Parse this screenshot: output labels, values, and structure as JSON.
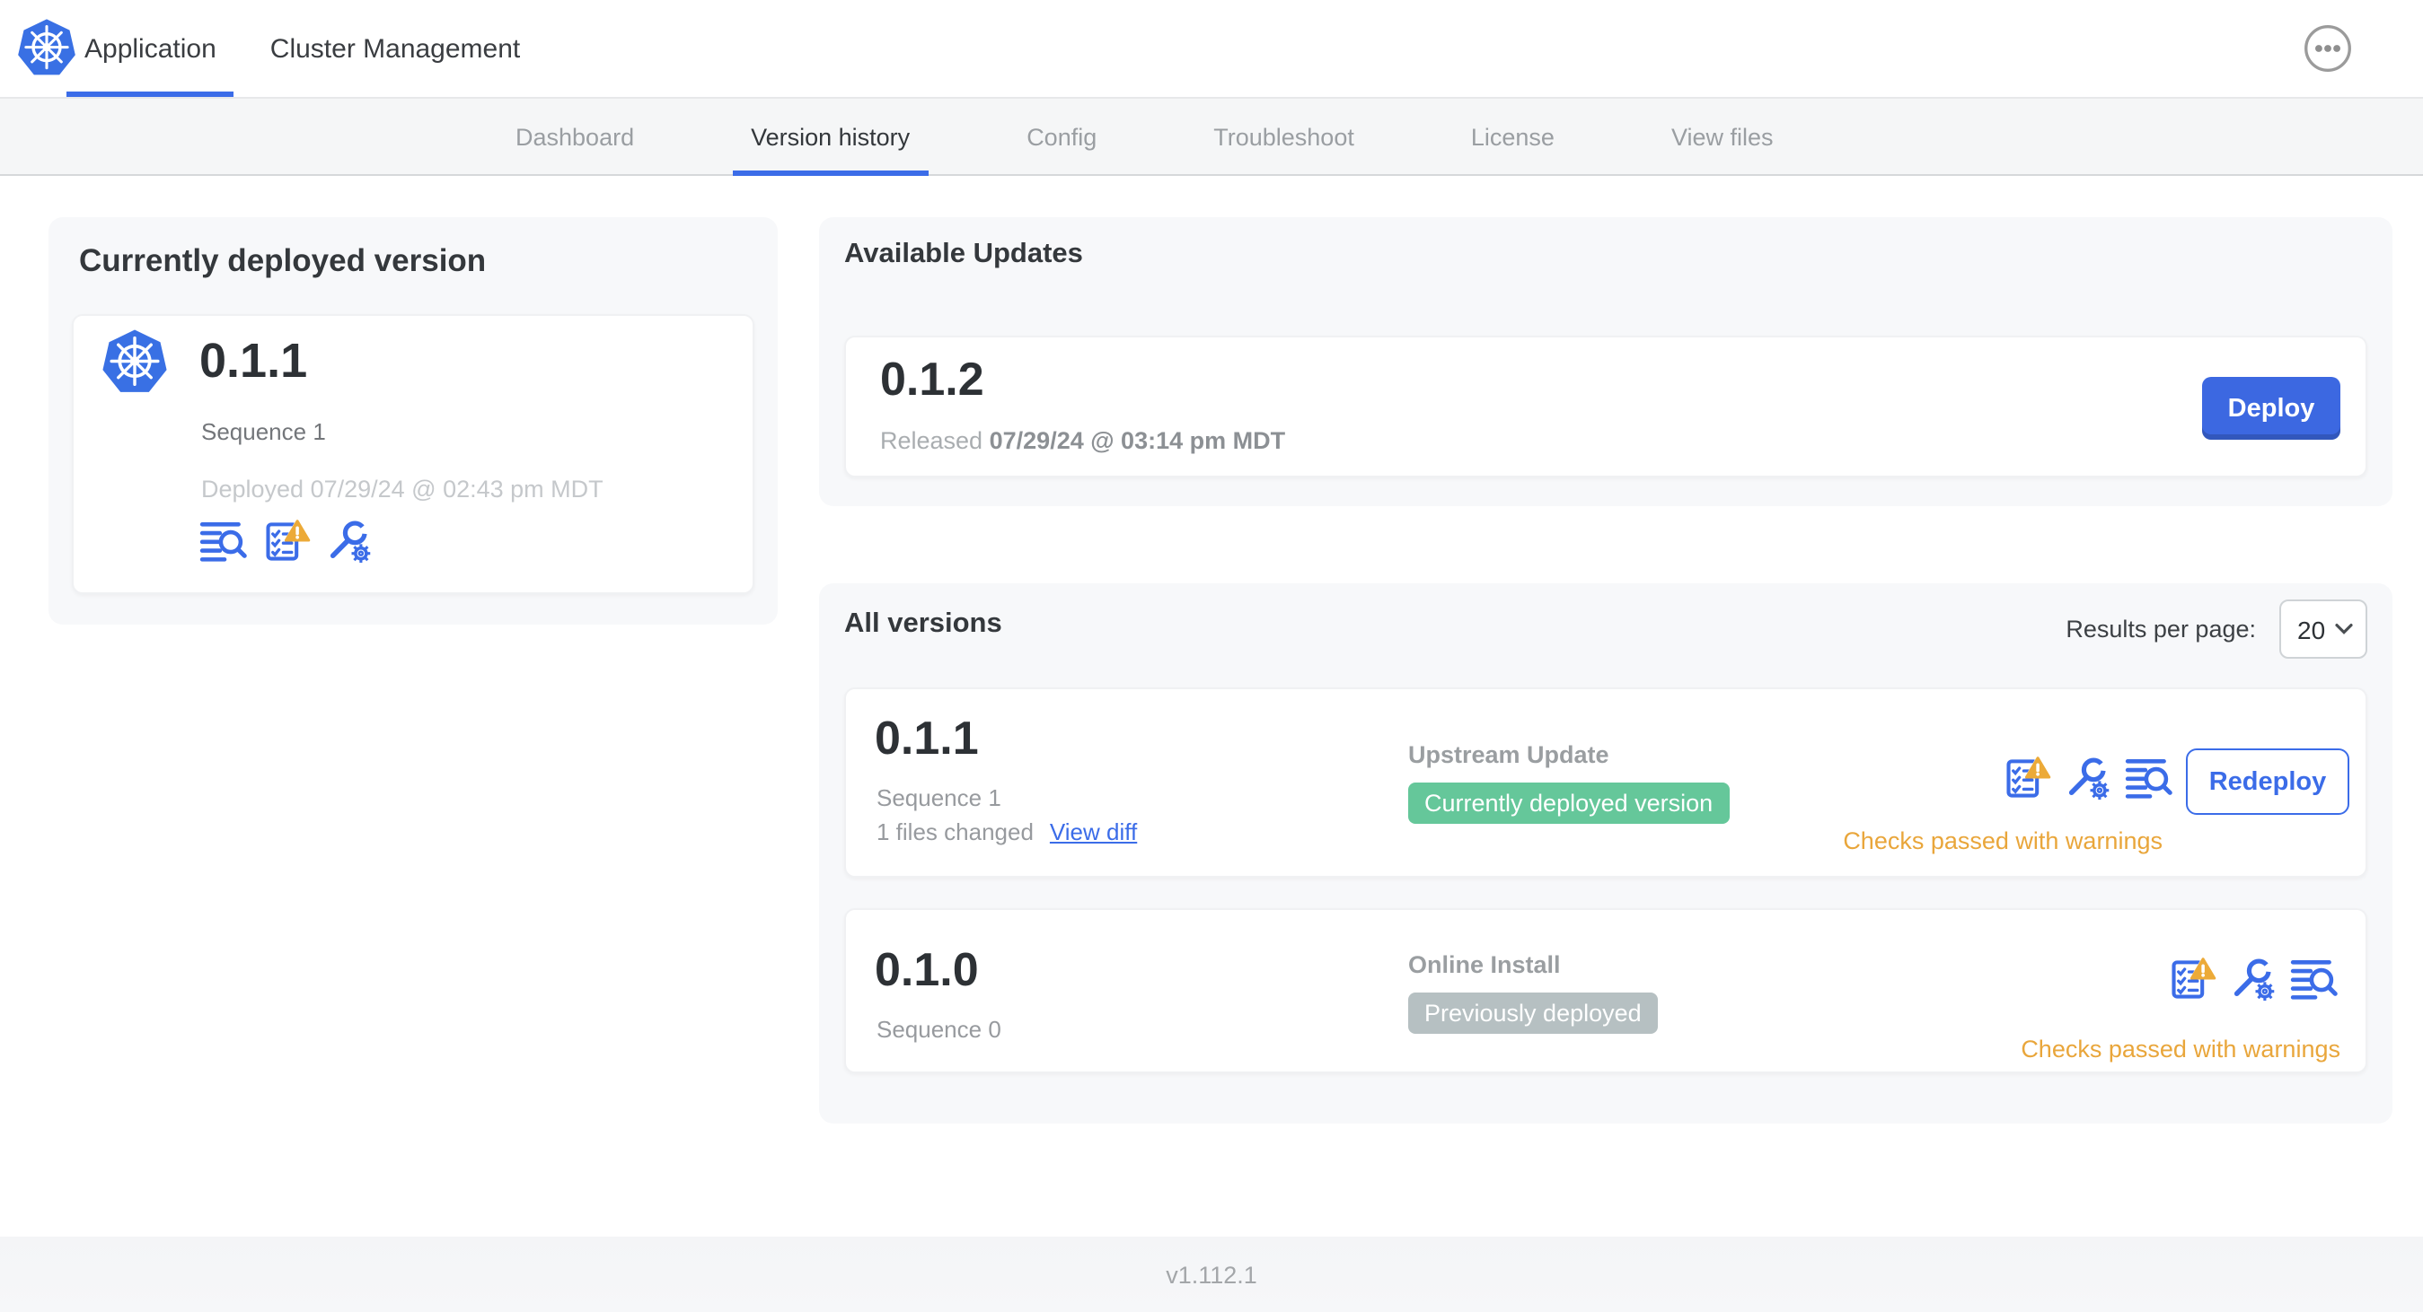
{
  "header": {
    "logo_icon": "kubernetes-logo",
    "tabs": [
      {
        "label": "Application",
        "active": true
      },
      {
        "label": "Cluster Management",
        "active": false
      }
    ],
    "menu_icon": "ellipsis-icon"
  },
  "subnav": {
    "tabs": [
      {
        "label": "Dashboard",
        "active": false
      },
      {
        "label": "Version history",
        "active": true
      },
      {
        "label": "Config",
        "active": false
      },
      {
        "label": "Troubleshoot",
        "active": false
      },
      {
        "label": "License",
        "active": false
      },
      {
        "label": "View files",
        "active": false
      }
    ]
  },
  "current_version": {
    "title": "Currently deployed version",
    "app_icon": "kubernetes-logo",
    "version": "0.1.1",
    "sequence": "Sequence 1",
    "deployed": "Deployed 07/29/24 @ 02:43 pm MDT",
    "icons": [
      "logs-icon",
      "preflight-checks-warning-icon",
      "config-tools-icon"
    ]
  },
  "available_updates": {
    "title": "Available Updates",
    "version": "0.1.2",
    "released_label": "Released",
    "released_date": "07/29/24 @ 03:14 pm MDT",
    "deploy_label": "Deploy"
  },
  "all_versions": {
    "title": "All versions",
    "results_per_page_label": "Results per page:",
    "results_per_page_value": "20",
    "rows": [
      {
        "version": "0.1.1",
        "sequence": "Sequence 1",
        "files_changed": "1 files changed",
        "view_diff_label": "View diff",
        "source": "Upstream Update",
        "badge_label": "Currently deployed version",
        "badge_color": "#65c79a",
        "icons": [
          "preflight-checks-warning-icon",
          "config-tools-icon",
          "logs-icon"
        ],
        "status": "Checks passed with warnings",
        "action_label": "Redeploy"
      },
      {
        "version": "0.1.0",
        "sequence": "Sequence 0",
        "source": "Online Install",
        "badge_label": "Previously deployed",
        "badge_color": "#b6c0c2",
        "icons": [
          "preflight-checks-warning-icon",
          "config-tools-icon",
          "logs-icon"
        ],
        "status": "Checks passed with warnings"
      }
    ]
  },
  "footer": {
    "version": "v1.112.1"
  },
  "colors": {
    "accent_blue": "#3b6ce8",
    "warning_orange": "#e9a63b",
    "badge_green": "#65c79a",
    "badge_gray": "#b6c0c2",
    "section_bg": "#f7f8fa"
  }
}
